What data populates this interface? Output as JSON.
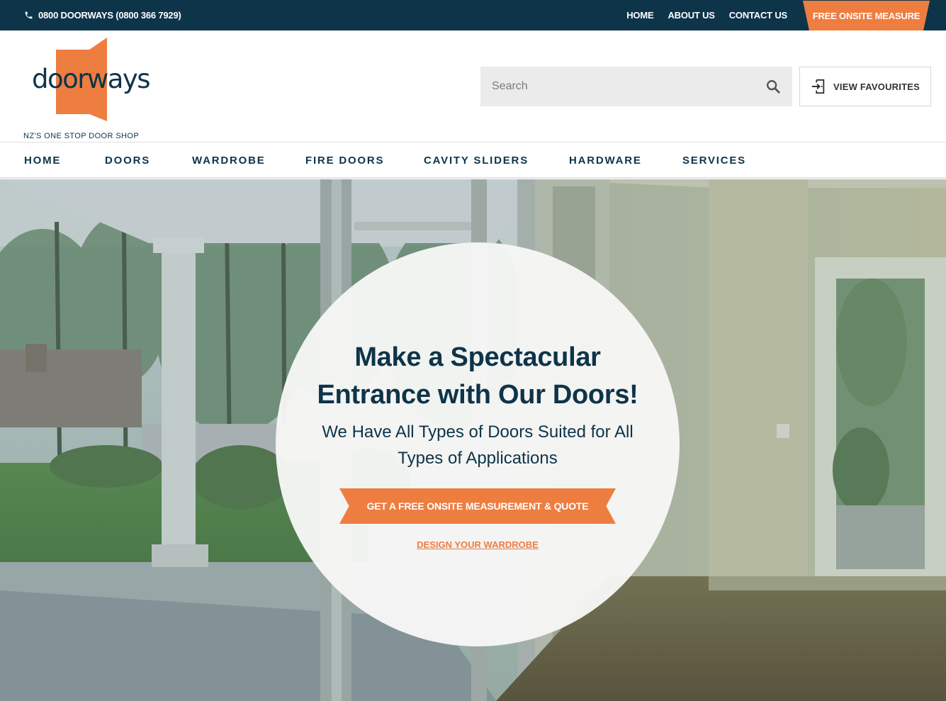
{
  "topbar": {
    "phone": "0800 DOORWAYS (0800 366 7929)",
    "links": [
      "HOME",
      "ABOUT US",
      "CONTACT US"
    ],
    "measure_button": "FREE ONSITE MEASURE"
  },
  "header": {
    "logo_text": "doorways",
    "tagline": "NZ'S ONE STOP DOOR SHOP",
    "search_placeholder": "Search",
    "favourites_label": "VIEW FAVOURITES"
  },
  "nav": {
    "items": [
      "HOME",
      "DOORS",
      "WARDROBE",
      "FIRE DOORS",
      "CAVITY SLIDERS",
      "HARDWARE",
      "SERVICES"
    ]
  },
  "hero": {
    "title_line1": "Make a Spectacular",
    "title_line2": "Entrance with Our Doors!",
    "subtitle_line1": "We Have All Types of Doors Suited for All",
    "subtitle_line2": "Types of Applications",
    "cta_label": "GET A FREE ONSITE MEASUREMENT & QUOTE",
    "secondary_link": "DESIGN YOUR WARDROBE"
  },
  "colors": {
    "navy": "#0e3449",
    "orange": "#ee7d40"
  },
  "icons": {
    "phone": "phone-icon",
    "search": "search-icon",
    "favourites": "enter-door-icon"
  }
}
